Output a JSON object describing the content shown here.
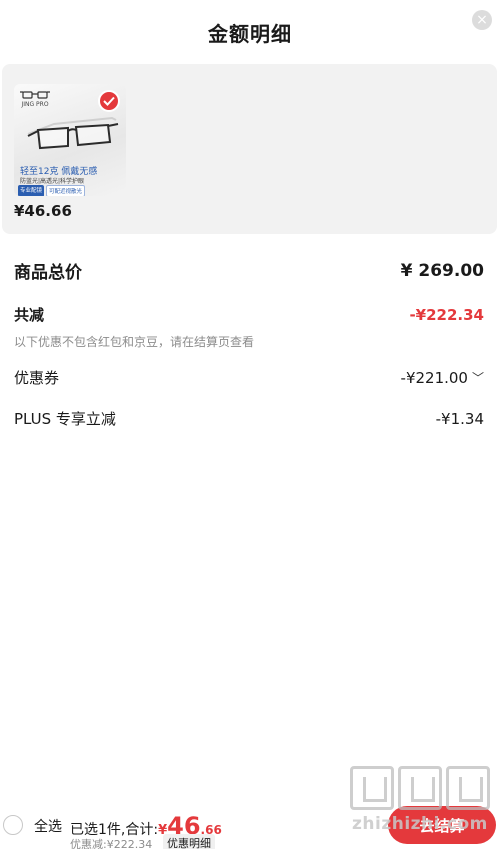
{
  "header": {
    "title": "金额明细",
    "close_glyph": "×"
  },
  "product": {
    "price": "¥46.66",
    "brand": "JING PRO",
    "promo_title": "轻至12克 佩戴无感",
    "promo_sub": "防蓝光|高透光|科学护眼",
    "promo_tags": [
      "专业配镜",
      "可配近视散光"
    ],
    "selected": true
  },
  "summary": {
    "total_label": "商品总价",
    "total_value": "¥ 269.00",
    "reduce_label": "共减",
    "reduce_value": "-¥222.34",
    "note": "以下优惠不包含红包和京豆，请在结算页查看",
    "lines": [
      {
        "label": "优惠券",
        "value": "-¥221.00",
        "expandable": true
      },
      {
        "label": "PLUS 专享立减",
        "value": "-¥1.34",
        "expandable": false
      }
    ]
  },
  "footer": {
    "select_all": "全选",
    "selected_text": "已选1件,合计:",
    "currency": "¥",
    "total_int": "46",
    "total_dec": ".66",
    "discount_text": "优惠减:¥222.34",
    "detail_button": "优惠明细",
    "checkout_button": "去结算"
  },
  "watermark": {
    "text": "zhizhizhi.com"
  },
  "colors": {
    "accent": "#e4393c",
    "panel_bg": "#f2f2f2",
    "muted": "#8c8c8c"
  }
}
